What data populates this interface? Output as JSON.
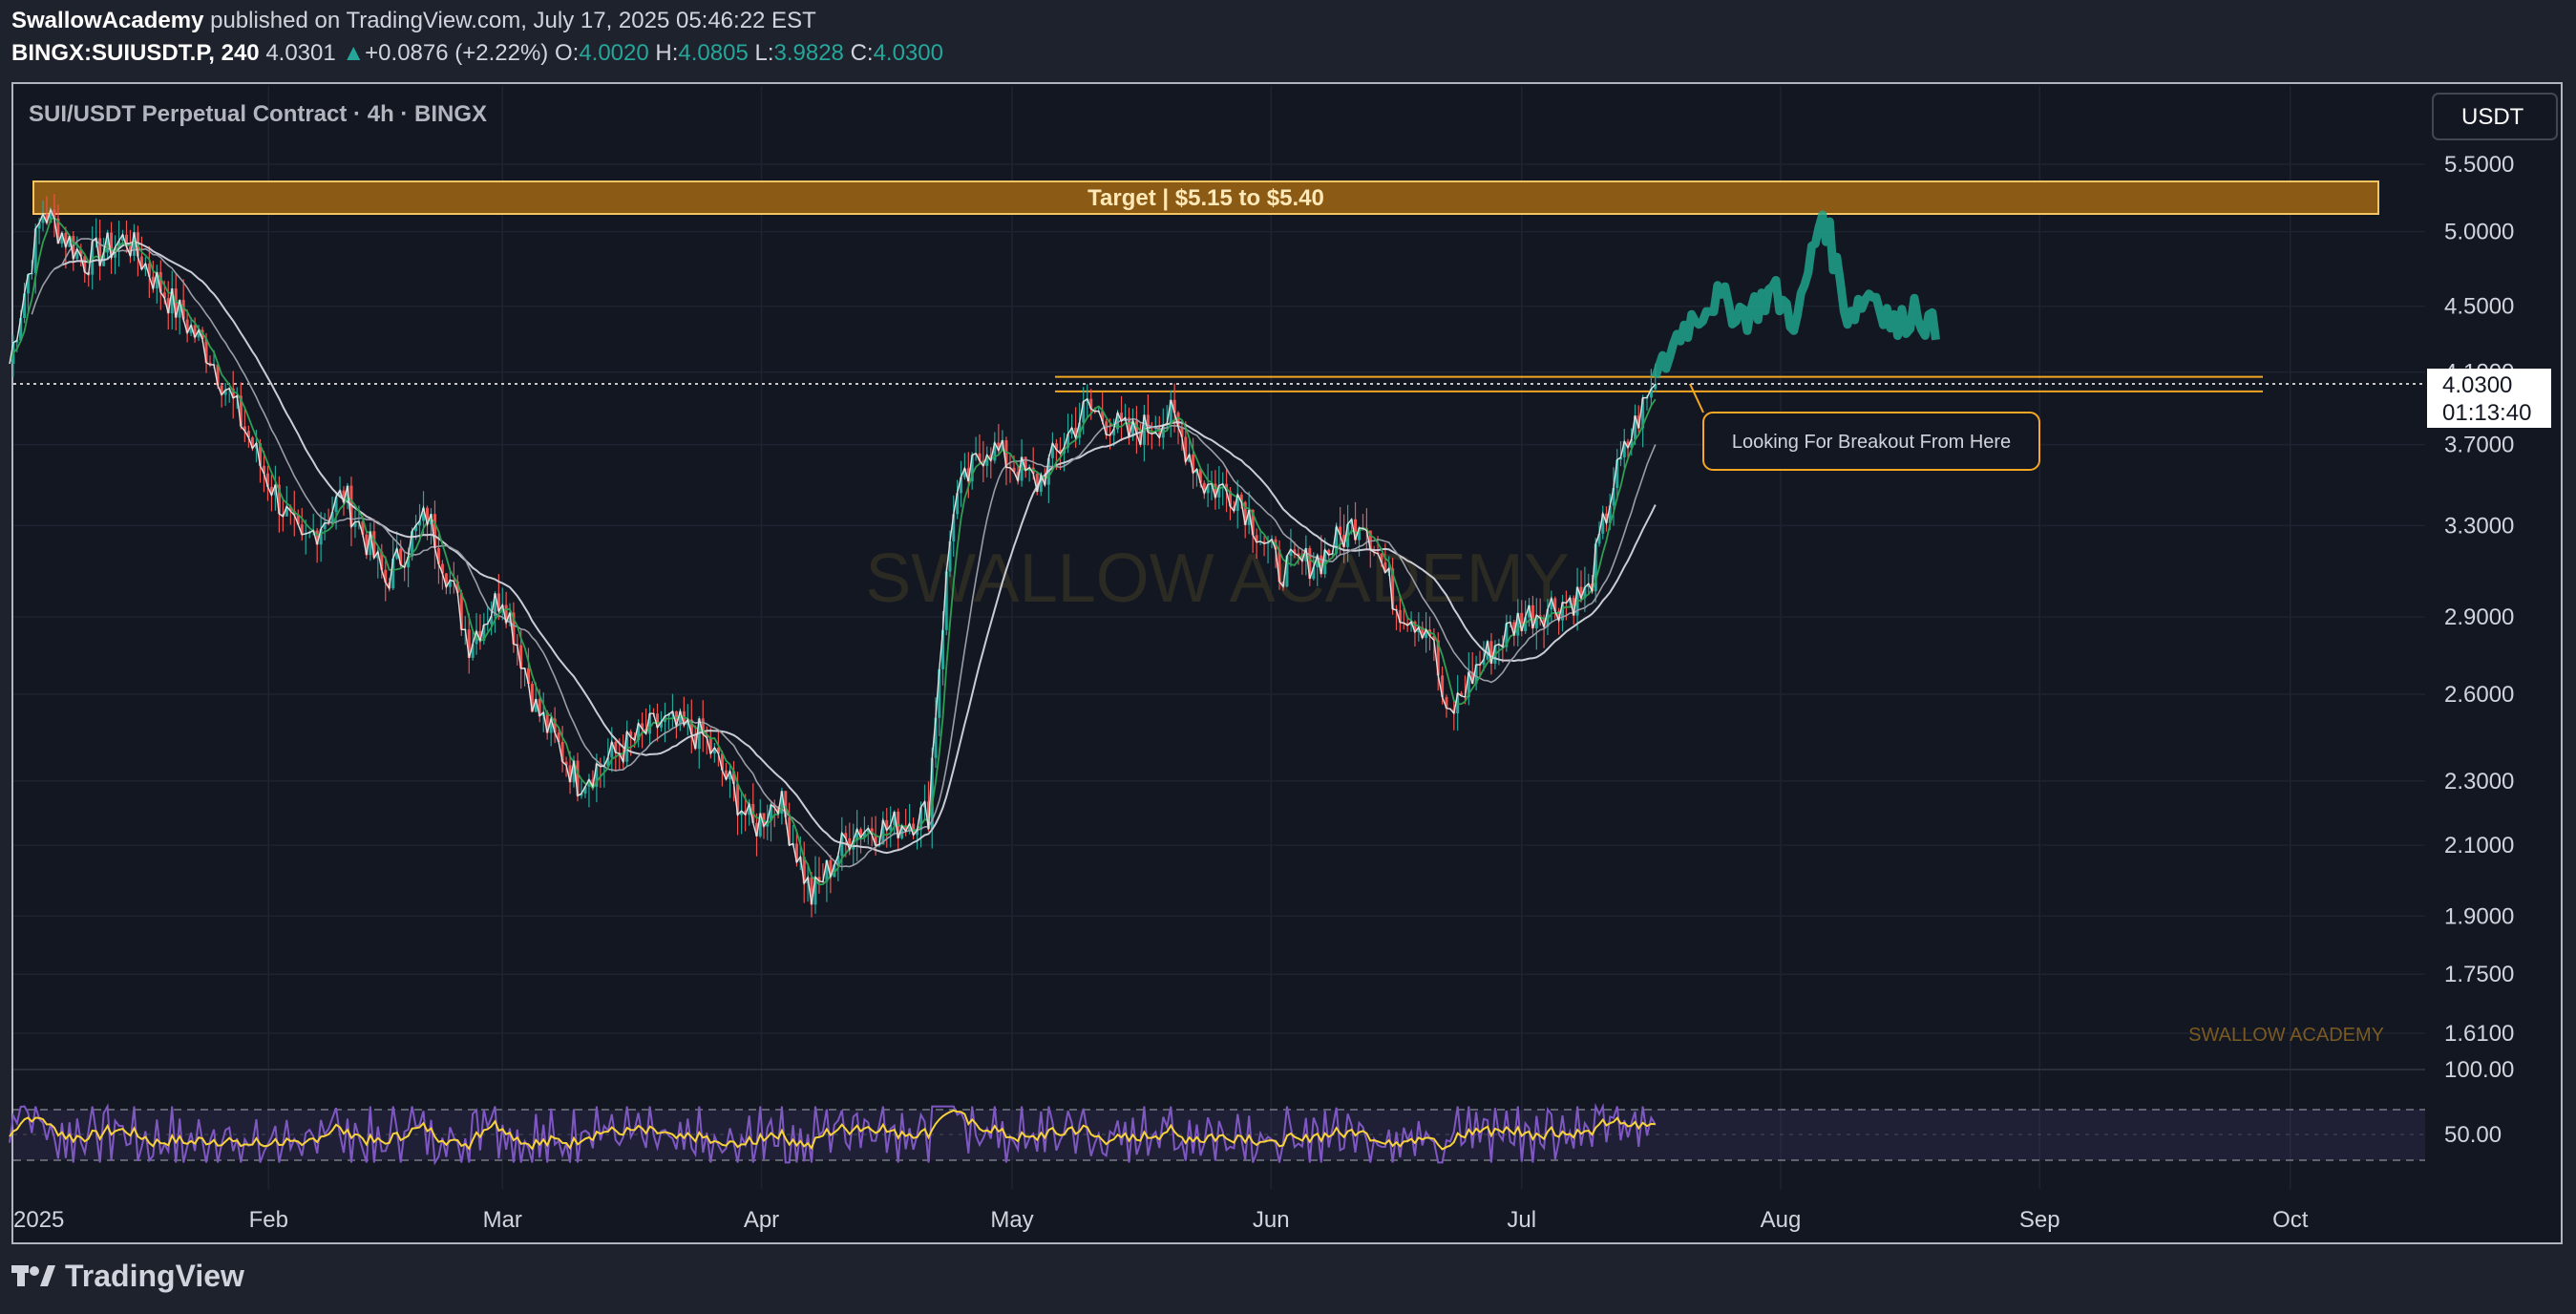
{
  "header": {
    "publisher": "SwallowAcademy",
    "published_text": "published on TradingView.com, July 17, 2025 05:46:22 EST",
    "symbol": "BINGX:SUIUSDT.P, 240",
    "last": "4.0301",
    "change": "+0.0876 (+2.22%)",
    "o_label": "O:",
    "o_value": "4.0020",
    "h_label": "H:",
    "h_value": "4.0805",
    "l_label": "L:",
    "l_value": "3.9828",
    "c_label": "C:",
    "c_value": "4.0300"
  },
  "legend_title": "SUI/USDT Perpetual Contract · 4h · BINGX",
  "currency_button": "USDT",
  "watermark": "SWALLOW ACADEMY",
  "brand_small": "SWALLOW ACADEMY",
  "price_label": {
    "value": "4.0300",
    "countdown": "01:13:40"
  },
  "annotations": {
    "target_zone": "Target | $5.15 to $5.40",
    "breakout_callout": "Looking For Breakout From Here"
  },
  "footer_brand": "TradingView",
  "colors": {
    "background": "#131722",
    "up": "#26a69a",
    "down": "#ef5350",
    "target_zone": "#8b5a14",
    "zone_line": "#f5a623",
    "rsi": "#7e57c2",
    "rsi_ma": "#f7d23a"
  },
  "chart_data": {
    "type": "line",
    "x_axis_ticks": [
      "2025",
      "Feb",
      "Mar",
      "Apr",
      "May",
      "Jun",
      "Jul",
      "Aug",
      "Sep",
      "Oct"
    ],
    "y_axis_ticks": [
      "5.5000",
      "5.0000",
      "4.5000",
      "4.1000",
      "3.7000",
      "3.3000",
      "2.9000",
      "2.6000",
      "2.3000",
      "2.1000",
      "1.9000",
      "1.7500",
      "1.6100"
    ],
    "y_scale": "log",
    "ylim": [
      1.55,
      5.75
    ],
    "price_series": {
      "name": "",
      "x": [
        "2025-01-01",
        "2025-01-05",
        "2025-01-10",
        "2025-01-15",
        "2025-01-20",
        "2025-01-25",
        "2025-01-31",
        "2025-02-05",
        "2025-02-10",
        "2025-02-15",
        "2025-02-20",
        "2025-02-25",
        "2025-03-01",
        "2025-03-05",
        "2025-03-10",
        "2025-03-15",
        "2025-03-20",
        "2025-03-25",
        "2025-03-31",
        "2025-04-03",
        "2025-04-07",
        "2025-04-12",
        "2025-04-16",
        "2025-04-21",
        "2025-04-24",
        "2025-04-28",
        "2025-05-04",
        "2025-05-10",
        "2025-05-15",
        "2025-05-20",
        "2025-05-24",
        "2025-05-28",
        "2025-06-02",
        "2025-06-07",
        "2025-06-12",
        "2025-06-16",
        "2025-06-20",
        "2025-06-22",
        "2025-06-26",
        "2025-07-01",
        "2025-07-05",
        "2025-07-09",
        "2025-07-12",
        "2025-07-15",
        "2025-07-17"
      ],
      "values": [
        4.15,
        5.15,
        4.8,
        4.95,
        4.55,
        4.2,
        3.6,
        3.2,
        3.45,
        3.05,
        3.35,
        2.8,
        3.0,
        2.55,
        2.3,
        2.4,
        2.5,
        2.45,
        2.15,
        2.25,
        1.95,
        2.15,
        2.15,
        2.2,
        3.4,
        3.7,
        3.5,
        3.9,
        3.75,
        3.85,
        3.5,
        3.45,
        3.1,
        3.15,
        3.35,
        2.95,
        2.85,
        2.5,
        2.72,
        2.9,
        2.95,
        3.0,
        3.5,
        3.85,
        4.03
      ]
    },
    "projection": {
      "x": [
        "2025-07-17",
        "2025-07-20",
        "2025-07-24",
        "2025-07-28",
        "2025-07-31",
        "2025-08-03",
        "2025-08-06",
        "2025-08-09",
        "2025-08-12",
        "2025-08-15",
        "2025-08-17",
        "2025-08-20"
      ],
      "values": [
        4.03,
        4.35,
        4.55,
        4.45,
        4.6,
        4.4,
        5.15,
        4.45,
        4.6,
        4.35,
        4.5,
        4.3
      ]
    },
    "resistance_zone": {
      "low": 4.0,
      "high": 4.1
    },
    "target_zone": {
      "low": 5.15,
      "high": 5.4
    },
    "rsi_ticks": [
      "100.00",
      "50.00"
    ]
  }
}
